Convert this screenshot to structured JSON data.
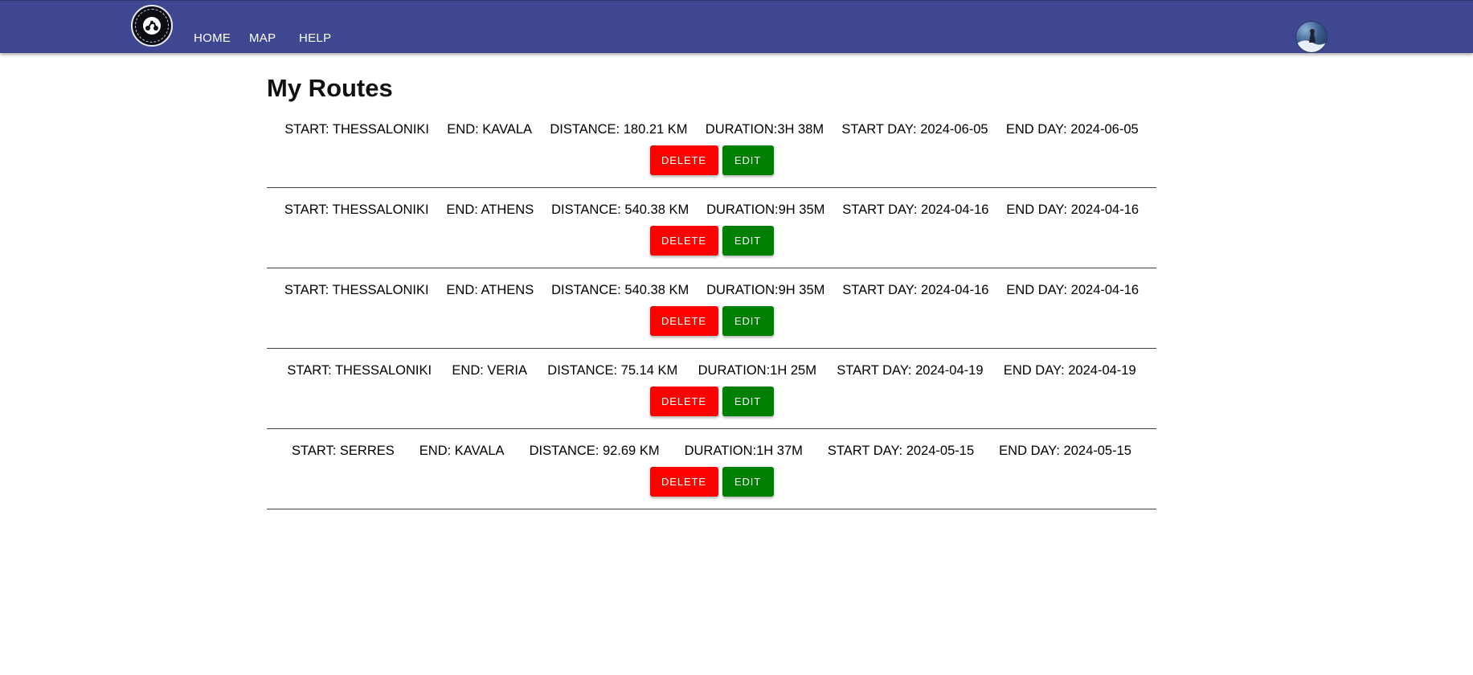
{
  "header": {
    "nav": [
      "HOME",
      "MAP",
      "HELP"
    ],
    "brand_color": "#3f4791",
    "logo_icon": "motorbike-logo-icon",
    "avatar_icon": "user-avatar-icon"
  },
  "main": {
    "title": "My Routes",
    "routes": [
      {
        "start": "START: THESSALONIKI",
        "end": "END: KAVALA",
        "distance": "DISTANCE: 180.21 KM",
        "duration": "DURATION:3H 38M",
        "start_day": "START DAY: 2024-06-05",
        "end_day": "END DAY: 2024-06-05",
        "delete_label": "DELETE",
        "edit_label": "EDIT"
      },
      {
        "start": "START: THESSALONIKI",
        "end": "END: ATHENS",
        "distance": "DISTANCE: 540.38 KM",
        "duration": "DURATION:9H 35M",
        "start_day": "START DAY: 2024-04-16",
        "end_day": "END DAY: 2024-04-16",
        "delete_label": "DELETE",
        "edit_label": "EDIT"
      },
      {
        "start": "START: THESSALONIKI",
        "end": "END: ATHENS",
        "distance": "DISTANCE: 540.38 KM",
        "duration": "DURATION:9H 35M",
        "start_day": "START DAY: 2024-04-16",
        "end_day": "END DAY: 2024-04-16",
        "delete_label": "DELETE",
        "edit_label": "EDIT"
      },
      {
        "start": "START: THESSALONIKI",
        "end": "END: VERIA",
        "distance": "DISTANCE: 75.14 KM",
        "duration": "DURATION:1H 25M",
        "start_day": "START DAY: 2024-04-19",
        "end_day": "END DAY: 2024-04-19",
        "delete_label": "DELETE",
        "edit_label": "EDIT"
      },
      {
        "start": "START: SERRES",
        "end": "END: KAVALA",
        "distance": "DISTANCE: 92.69 KM",
        "duration": "DURATION:1H 37M",
        "start_day": "START DAY: 2024-05-15",
        "end_day": "END DAY: 2024-05-15",
        "delete_label": "DELETE",
        "edit_label": "EDIT"
      }
    ],
    "colors": {
      "delete": "#ff0000",
      "edit": "#008000"
    }
  }
}
